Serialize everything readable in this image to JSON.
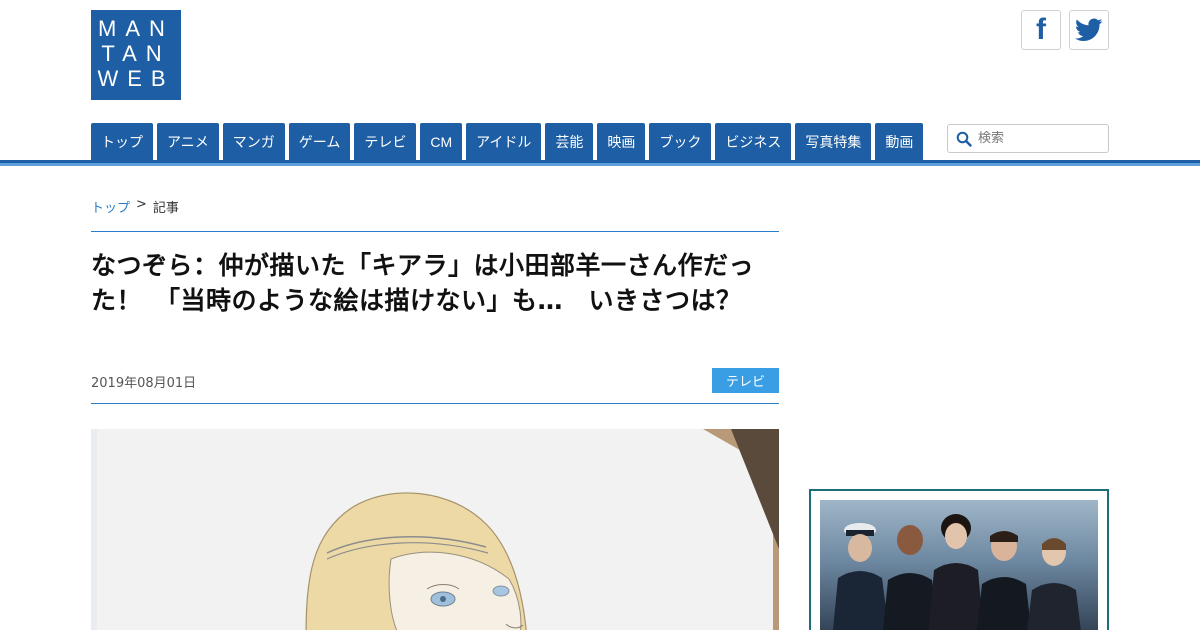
{
  "logo": {
    "lines": [
      "MAN",
      "TAN",
      "WEB"
    ]
  },
  "social": {
    "facebook_icon": "facebook-icon",
    "twitter_icon": "twitter-icon"
  },
  "nav": {
    "items": [
      "トップ",
      "アニメ",
      "マンガ",
      "ゲーム",
      "テレビ",
      "CM",
      "アイドル",
      "芸能",
      "映画",
      "ブック",
      "ビジネス",
      "写真特集",
      "動画"
    ]
  },
  "search": {
    "placeholder": "検索",
    "icon": "search-icon"
  },
  "breadcrumb": {
    "home": "トップ",
    "separator": ">",
    "current": "記事"
  },
  "article": {
    "title": "なつぞら：仲が描いた「キアラ」は小田部羊一さん作だった！　「当時のような絵は描けない」も…　いきさつは？",
    "date": "2019年08月01日",
    "category": "テレビ"
  },
  "colors": {
    "brand_blue": "#1d5ea4",
    "accent_blue": "#3a9ee4",
    "link_blue": "#2a7cc7",
    "ad_border": "#1d6e78"
  }
}
